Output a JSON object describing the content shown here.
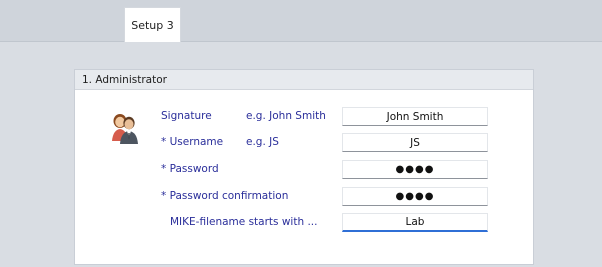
{
  "tabs": [
    {
      "label": "Setup 3",
      "active": true
    }
  ],
  "section": {
    "title": "1. Administrator"
  },
  "form": {
    "signature": {
      "label": "Signature",
      "example": "e.g.  John Smith",
      "value": "John Smith"
    },
    "username": {
      "label": "* Username",
      "example": "e.g.  JS",
      "value": "JS"
    },
    "password": {
      "label": "* Password",
      "value": "●●●●"
    },
    "password_confirmation": {
      "label": "* Password  confirmation",
      "value": "●●●●"
    },
    "mike_filename": {
      "label": "MIKE-filename starts with ...",
      "value": "Lab"
    }
  },
  "icons": {
    "avatar": "users-icon"
  },
  "colors": {
    "label_text": "#2a2e9a",
    "active_field_border": "#2f6fd6",
    "header_bar": "#cfd4db",
    "background": "#d9dde3"
  }
}
